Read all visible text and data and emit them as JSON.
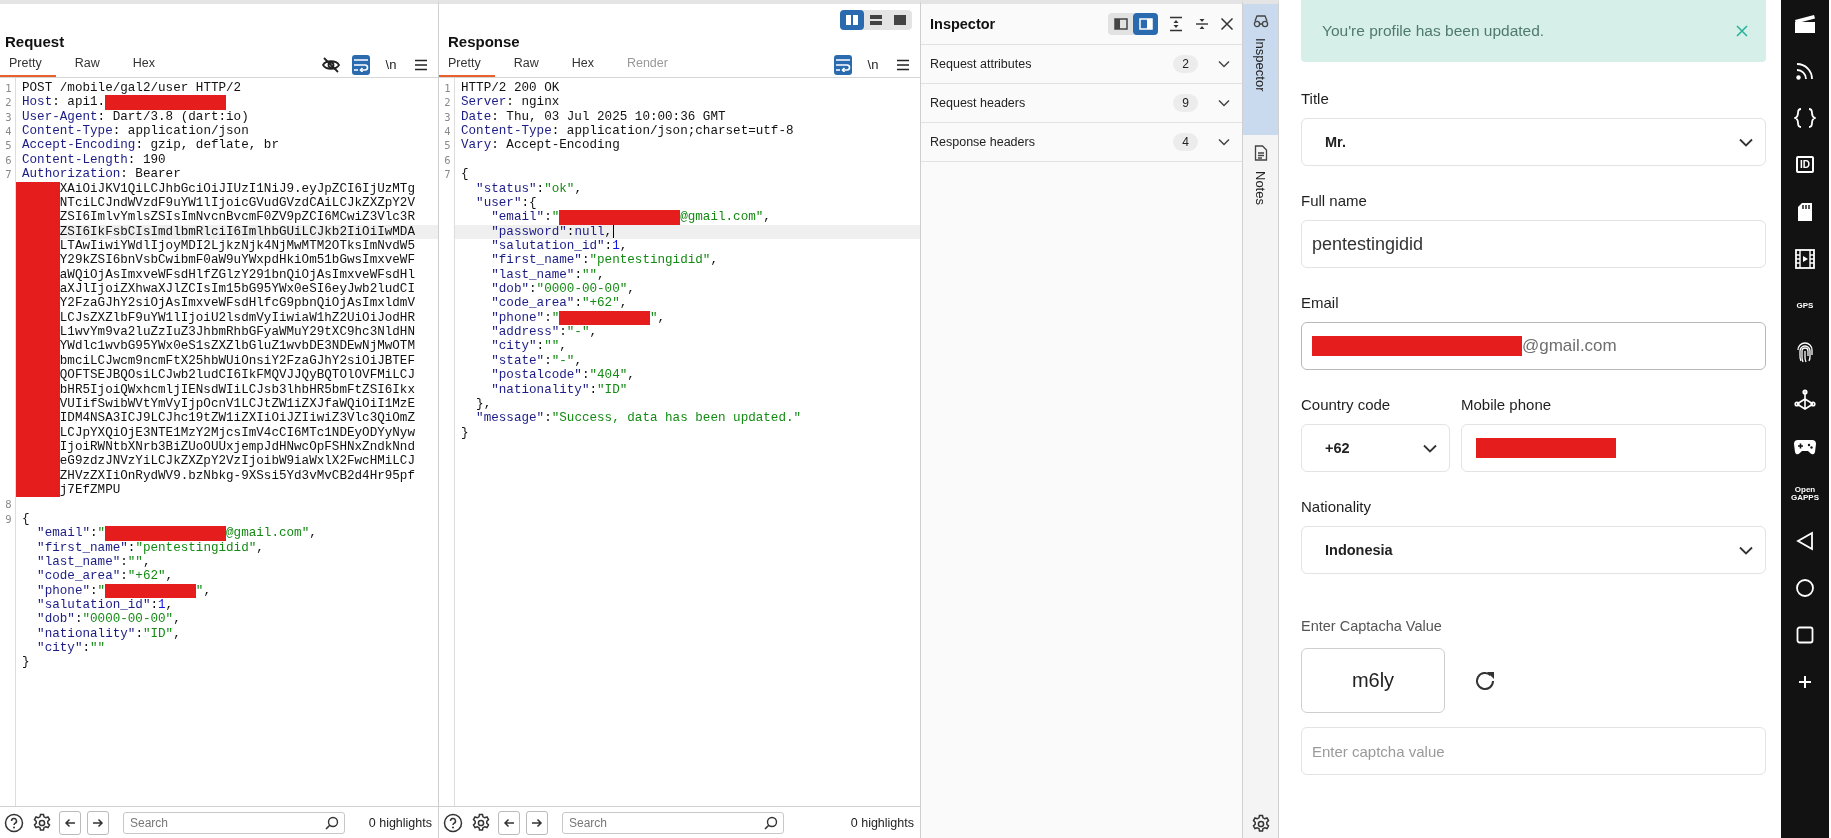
{
  "request_pane": {
    "title": "Request",
    "tabs": [
      {
        "label": "Pretty",
        "selected": true,
        "disabled": false
      },
      {
        "label": "Raw",
        "selected": false,
        "disabled": false
      },
      {
        "label": "Hex",
        "selected": false,
        "disabled": false
      }
    ],
    "toolbar": [
      {
        "kind": "eye-off",
        "on": false
      },
      {
        "kind": "wrap",
        "on": true
      },
      {
        "kind": "newline",
        "label": "\\n",
        "on": false
      },
      {
        "kind": "menu",
        "on": false
      }
    ],
    "lines": [
      {
        "number": "1",
        "highlighted": false,
        "parts": [
          {
            "kind": "plain",
            "text": "POST /mobile/gal2/user HTTP/2"
          }
        ]
      },
      {
        "number": "2",
        "highlighted": false,
        "parts": [
          {
            "kind": "key",
            "text": "Host"
          },
          {
            "kind": "plain",
            "text": ": api1."
          },
          {
            "kind": "redacted-long"
          }
        ]
      },
      {
        "number": "3",
        "highlighted": false,
        "parts": [
          {
            "kind": "key",
            "text": "User-Agent"
          },
          {
            "kind": "plain",
            "text": ": Dart/3.8 (dart:io)"
          }
        ]
      },
      {
        "number": "4",
        "highlighted": false,
        "parts": [
          {
            "kind": "key",
            "text": "Content-Type"
          },
          {
            "kind": "plain",
            "text": ": application/json"
          }
        ]
      },
      {
        "number": "5",
        "highlighted": false,
        "parts": [
          {
            "kind": "key",
            "text": "Accept-Encoding"
          },
          {
            "kind": "plain",
            "text": ": gzip, deflate, br"
          }
        ]
      },
      {
        "number": "6",
        "highlighted": false,
        "parts": [
          {
            "kind": "key",
            "text": "Content-Length"
          },
          {
            "kind": "plain",
            "text": ": 190"
          }
        ]
      },
      {
        "number": "7",
        "highlighted": false,
        "parts": [
          {
            "kind": "key",
            "text": "Authorization"
          },
          {
            "kind": "plain",
            "text": ": Bearer"
          }
        ]
      },
      {
        "highlighted": false,
        "parts": [
          {
            "kind": "redacted-token"
          },
          {
            "kind": "plain",
            "text": "XAiOiJKV1QiLCJhbGciOiJIUzI1NiJ9.eyJpZCI6IjUzMTg"
          }
        ]
      },
      {
        "highlighted": false,
        "parts": [
          {
            "kind": "redacted-token"
          },
          {
            "kind": "plain",
            "text": "NTciLCJndWVzdF9uYW1lIjoicGVudGVzdCAiLCJkZXZpY2V"
          }
        ]
      },
      {
        "highlighted": false,
        "parts": [
          {
            "kind": "redacted-token"
          },
          {
            "kind": "plain",
            "text": "ZSI6ImlvYmlsZSIsImNvcnBvcmF0ZV9pZCI6MCwiZ3Vlc3R"
          }
        ]
      },
      {
        "highlighted": true,
        "parts": [
          {
            "kind": "redacted-token"
          },
          {
            "kind": "plain",
            "text": "ZSI6IkFsbCIsImdlbmRlciI6ImlhbGUiLCJkb2IiOiIwMDA"
          }
        ]
      },
      {
        "highlighted": false,
        "parts": [
          {
            "kind": "redacted-token"
          },
          {
            "kind": "plain",
            "text": "LTAwIiwiYWdlIjoyMDI2LjkzNjk4NjMwMTM2OTksImNvdW5"
          }
        ]
      },
      {
        "highlighted": false,
        "parts": [
          {
            "kind": "redacted-token"
          },
          {
            "kind": "plain",
            "text": "Y29kZSI6bnVsbCwibmF0aW9uYWxpdHkiOm51bGwsImxveWF"
          }
        ]
      },
      {
        "highlighted": false,
        "parts": [
          {
            "kind": "redacted-token"
          },
          {
            "kind": "plain",
            "text": "aWQiOjAsImxveWFsdHlfZGlzY291bnQiOjAsImxveWFsdHl"
          }
        ]
      },
      {
        "highlighted": false,
        "parts": [
          {
            "kind": "redacted-token"
          },
          {
            "kind": "plain",
            "text": "aXJlIjoiZXhwaXJlZCIsIm15bG95YWx0eSI6eyJwb2ludCI"
          }
        ]
      },
      {
        "highlighted": false,
        "parts": [
          {
            "kind": "redacted-token"
          },
          {
            "kind": "plain",
            "text": "Y2FzaGJhY2siOjAsImxveWFsdHlfcG9pbnQiOjAsImxldmV"
          }
        ]
      },
      {
        "highlighted": false,
        "parts": [
          {
            "kind": "redacted-token"
          },
          {
            "kind": "plain",
            "text": "LCJsZXZlbF9uYW1lIjoiU2lsdmVyIiwiaW1hZ2UiOiJodHR"
          }
        ]
      },
      {
        "highlighted": false,
        "parts": [
          {
            "kind": "redacted-token"
          },
          {
            "kind": "plain",
            "text": "L1wvYm9va2luZzIuZ3JhbmRhbGFyaWMuY29tXC9hc3NldHN"
          }
        ]
      },
      {
        "highlighted": false,
        "parts": [
          {
            "kind": "redacted-token"
          },
          {
            "kind": "plain",
            "text": "YWdlc1wvbG95YWx0eS1sZXZlbGluZ1wvbDE3NDEwNjMwOTM"
          }
        ]
      },
      {
        "highlighted": false,
        "parts": [
          {
            "kind": "redacted-token"
          },
          {
            "kind": "plain",
            "text": "bmciLCJwcm9ncmFtX25hbWUiOnsiY2FzaGJhY2siOiJBTEF"
          }
        ]
      },
      {
        "highlighted": false,
        "parts": [
          {
            "kind": "redacted-token"
          },
          {
            "kind": "plain",
            "text": "QOFTSEJBQOsiLCJwb2ludCI6IkFMQVJJQyBQTOlOVFMiLCJ"
          }
        ]
      },
      {
        "highlighted": false,
        "parts": [
          {
            "kind": "redacted-token"
          },
          {
            "kind": "plain",
            "text": "bHR5IjoiQWxhcmljIENsdWIiLCJsb3lhbHR5bmFtZSI6Ikx"
          }
        ]
      },
      {
        "highlighted": false,
        "parts": [
          {
            "kind": "redacted-token"
          },
          {
            "kind": "plain",
            "text": "VUIifSwibWVtYmVyIjpOcnV1LCJtZW1iZXJfaWQiOiI1MzE"
          }
        ]
      },
      {
        "highlighted": false,
        "parts": [
          {
            "kind": "redacted-token"
          },
          {
            "kind": "plain",
            "text": "IDM4NSA3ICJ9LCJhc19tZW1iZXIiOiJZIiwiZ3Vlc3QiOmZ"
          }
        ]
      },
      {
        "highlighted": false,
        "parts": [
          {
            "kind": "redacted-token"
          },
          {
            "kind": "plain",
            "text": "LCJpYXQiOjE3NTE1MzY2MjcsImV4cCI6MTc1NDEyODYyNyw"
          }
        ]
      },
      {
        "highlighted": false,
        "parts": [
          {
            "kind": "redacted-token"
          },
          {
            "kind": "plain",
            "text": "IjoiRWNtbXNrb3BiZUoOUUxjempJdHNwcOpFSHNxZndkNnd"
          }
        ]
      },
      {
        "highlighted": false,
        "parts": [
          {
            "kind": "redacted-token"
          },
          {
            "kind": "plain",
            "text": "eG9zdzJNVzYiLCJkZXZpY2VzIjoibW9iaWxlX2FwcHMiLCJ"
          }
        ]
      },
      {
        "highlighted": false,
        "parts": [
          {
            "kind": "redacted-token"
          },
          {
            "kind": "plain",
            "text": "ZHVzZXIiOnRydWV9.bzNbkg-9XSsi5Yd3vMvCB2d4Hr95pf"
          }
        ]
      },
      {
        "highlighted": false,
        "parts": [
          {
            "kind": "redacted-token"
          },
          {
            "kind": "plain",
            "text": "j7EfZMPU"
          }
        ]
      },
      {
        "number": "8",
        "highlighted": false
      },
      {
        "number": "9",
        "highlighted": false,
        "parts": [
          {
            "kind": "plain",
            "text": "{"
          }
        ]
      },
      {
        "highlighted": false,
        "parts": [
          {
            "kind": "key",
            "text": "  \"email\""
          },
          {
            "kind": "plain",
            "text": ":"
          },
          {
            "kind": "string",
            "text": "\""
          },
          {
            "kind": "redacted-long"
          },
          {
            "kind": "string",
            "text": "@gmail.com\""
          },
          {
            "kind": "plain",
            "text": ","
          }
        ]
      },
      {
        "highlighted": false,
        "parts": [
          {
            "kind": "key",
            "text": "  \"first_name\""
          },
          {
            "kind": "plain",
            "text": ":"
          },
          {
            "kind": "string",
            "text": "\"pentestingidid\""
          },
          {
            "kind": "plain",
            "text": ","
          }
        ]
      },
      {
        "highlighted": false,
        "parts": [
          {
            "kind": "key",
            "text": "  \"last_name\""
          },
          {
            "kind": "plain",
            "text": ":"
          },
          {
            "kind": "string",
            "text": "\"\""
          },
          {
            "kind": "plain",
            "text": ","
          }
        ]
      },
      {
        "highlighted": false,
        "parts": [
          {
            "kind": "key",
            "text": "  \"code_area\""
          },
          {
            "kind": "plain",
            "text": ":"
          },
          {
            "kind": "string",
            "text": "\"+62\""
          },
          {
            "kind": "plain",
            "text": ","
          }
        ]
      },
      {
        "highlighted": false,
        "parts": [
          {
            "kind": "key",
            "text": "  \"phone\""
          },
          {
            "kind": "plain",
            "text": ":"
          },
          {
            "kind": "string",
            "text": "\""
          },
          {
            "kind": "redacted-short"
          },
          {
            "kind": "string",
            "text": "\""
          },
          {
            "kind": "plain",
            "text": ","
          }
        ]
      },
      {
        "highlighted": false,
        "parts": [
          {
            "kind": "key",
            "text": "  \"salutation_id\""
          },
          {
            "kind": "plain",
            "text": ":"
          },
          {
            "kind": "number",
            "text": "1"
          },
          {
            "kind": "plain",
            "text": ","
          }
        ]
      },
      {
        "highlighted": false,
        "parts": [
          {
            "kind": "key",
            "text": "  \"dob\""
          },
          {
            "kind": "plain",
            "text": ":"
          },
          {
            "kind": "string",
            "text": "\"0000-00-00\""
          },
          {
            "kind": "plain",
            "text": ","
          }
        ]
      },
      {
        "highlighted": false,
        "parts": [
          {
            "kind": "key",
            "text": "  \"nationality\""
          },
          {
            "kind": "plain",
            "text": ":"
          },
          {
            "kind": "string",
            "text": "\"ID\""
          },
          {
            "kind": "plain",
            "text": ","
          }
        ]
      },
      {
        "highlighted": false,
        "parts": [
          {
            "kind": "key",
            "text": "  \"city\""
          },
          {
            "kind": "plain",
            "text": ":"
          },
          {
            "kind": "string",
            "text": "\"\""
          }
        ]
      },
      {
        "highlighted": false,
        "parts": [
          {
            "kind": "plain",
            "text": "}"
          }
        ]
      }
    ],
    "search": {
      "placeholder": "Search"
    },
    "highlights": "0 highlights"
  },
  "response_pane": {
    "title": "Response",
    "view_toggle": [
      {
        "kind": "columns",
        "selected": true
      },
      {
        "kind": "rows",
        "selected": false
      },
      {
        "kind": "single",
        "selected": false
      }
    ],
    "tabs": [
      {
        "label": "Pretty",
        "selected": true,
        "disabled": false
      },
      {
        "label": "Raw",
        "selected": false,
        "disabled": false
      },
      {
        "label": "Hex",
        "selected": false,
        "disabled": false
      },
      {
        "label": "Render",
        "selected": false,
        "disabled": true
      }
    ],
    "toolbar": [
      {
        "kind": "wrap",
        "on": true
      },
      {
        "kind": "newline",
        "label": "\\n",
        "on": false
      },
      {
        "kind": "menu",
        "on": false
      }
    ],
    "lines": [
      {
        "number": "1",
        "highlighted": false,
        "parts": [
          {
            "kind": "plain",
            "text": "HTTP/2 200 OK"
          }
        ]
      },
      {
        "number": "2",
        "highlighted": false,
        "parts": [
          {
            "kind": "key",
            "text": "Server"
          },
          {
            "kind": "plain",
            "text": ": nginx"
          }
        ]
      },
      {
        "number": "3",
        "highlighted": false,
        "parts": [
          {
            "kind": "key",
            "text": "Date"
          },
          {
            "kind": "plain",
            "text": ": Thu, 03 Jul 2025 10:00:36 GMT"
          }
        ]
      },
      {
        "number": "4",
        "highlighted": false,
        "parts": [
          {
            "kind": "key",
            "text": "Content-Type"
          },
          {
            "kind": "plain",
            "text": ": application/json;charset=utf-8"
          }
        ]
      },
      {
        "number": "5",
        "highlighted": false,
        "parts": [
          {
            "kind": "key",
            "text": "Vary"
          },
          {
            "kind": "plain",
            "text": ": Accept-Encoding"
          }
        ]
      },
      {
        "number": "6",
        "highlighted": false
      },
      {
        "number": "7",
        "highlighted": false,
        "parts": [
          {
            "kind": "plain",
            "text": "{"
          }
        ]
      },
      {
        "highlighted": false,
        "parts": [
          {
            "kind": "key",
            "text": "  \"status\""
          },
          {
            "kind": "plain",
            "text": ":"
          },
          {
            "kind": "string",
            "text": "\"ok\""
          },
          {
            "kind": "plain",
            "text": ","
          }
        ]
      },
      {
        "highlighted": false,
        "parts": [
          {
            "kind": "key",
            "text": "  \"user\""
          },
          {
            "kind": "plain",
            "text": ":{"
          }
        ]
      },
      {
        "highlighted": false,
        "parts": [
          {
            "kind": "key",
            "text": "    \"email\""
          },
          {
            "kind": "plain",
            "text": ":"
          },
          {
            "kind": "string",
            "text": "\""
          },
          {
            "kind": "redacted-long"
          },
          {
            "kind": "string",
            "text": "@gmail.com\""
          },
          {
            "kind": "plain",
            "text": ","
          }
        ]
      },
      {
        "highlighted": true,
        "parts": [
          {
            "kind": "key",
            "text": "    \"password\""
          },
          {
            "kind": "plain",
            "text": ":"
          },
          {
            "kind": "literal",
            "text": "null"
          },
          {
            "kind": "plain",
            "text": ","
          },
          {
            "kind": "caret"
          }
        ]
      },
      {
        "highlighted": false,
        "parts": [
          {
            "kind": "key",
            "text": "    \"salutation_id\""
          },
          {
            "kind": "plain",
            "text": ":"
          },
          {
            "kind": "number",
            "text": "1"
          },
          {
            "kind": "plain",
            "text": ","
          }
        ]
      },
      {
        "highlighted": false,
        "parts": [
          {
            "kind": "key",
            "text": "    \"first_name\""
          },
          {
            "kind": "plain",
            "text": ":"
          },
          {
            "kind": "string",
            "text": "\"pentestingidid\""
          },
          {
            "kind": "plain",
            "text": ","
          }
        ]
      },
      {
        "highlighted": false,
        "parts": [
          {
            "kind": "key",
            "text": "    \"last_name\""
          },
          {
            "kind": "plain",
            "text": ":"
          },
          {
            "kind": "string",
            "text": "\"\""
          },
          {
            "kind": "plain",
            "text": ","
          }
        ]
      },
      {
        "highlighted": false,
        "parts": [
          {
            "kind": "key",
            "text": "    \"dob\""
          },
          {
            "kind": "plain",
            "text": ":"
          },
          {
            "kind": "string",
            "text": "\"0000-00-00\""
          },
          {
            "kind": "plain",
            "text": ","
          }
        ]
      },
      {
        "highlighted": false,
        "parts": [
          {
            "kind": "key",
            "text": "    \"code_area\""
          },
          {
            "kind": "plain",
            "text": ":"
          },
          {
            "kind": "string",
            "text": "\"+62\""
          },
          {
            "kind": "plain",
            "text": ","
          }
        ]
      },
      {
        "highlighted": false,
        "parts": [
          {
            "kind": "key",
            "text": "    \"phone\""
          },
          {
            "kind": "plain",
            "text": ":"
          },
          {
            "kind": "string",
            "text": "\""
          },
          {
            "kind": "redacted-short"
          },
          {
            "kind": "string",
            "text": "\""
          },
          {
            "kind": "plain",
            "text": ","
          }
        ]
      },
      {
        "highlighted": false,
        "parts": [
          {
            "kind": "key",
            "text": "    \"address\""
          },
          {
            "kind": "plain",
            "text": ":"
          },
          {
            "kind": "string",
            "text": "\"-\""
          },
          {
            "kind": "plain",
            "text": ","
          }
        ]
      },
      {
        "highlighted": false,
        "parts": [
          {
            "kind": "key",
            "text": "    \"city\""
          },
          {
            "kind": "plain",
            "text": ":"
          },
          {
            "kind": "string",
            "text": "\"\""
          },
          {
            "kind": "plain",
            "text": ","
          }
        ]
      },
      {
        "highlighted": false,
        "parts": [
          {
            "kind": "key",
            "text": "    \"state\""
          },
          {
            "kind": "plain",
            "text": ":"
          },
          {
            "kind": "string",
            "text": "\"-\""
          },
          {
            "kind": "plain",
            "text": ","
          }
        ]
      },
      {
        "highlighted": false,
        "parts": [
          {
            "kind": "key",
            "text": "    \"postalcode\""
          },
          {
            "kind": "plain",
            "text": ":"
          },
          {
            "kind": "string",
            "text": "\"404\""
          },
          {
            "kind": "plain",
            "text": ","
          }
        ]
      },
      {
        "highlighted": false,
        "parts": [
          {
            "kind": "key",
            "text": "    \"nationality\""
          },
          {
            "kind": "plain",
            "text": ":"
          },
          {
            "kind": "string",
            "text": "\"ID\""
          }
        ]
      },
      {
        "highlighted": false,
        "parts": [
          {
            "kind": "plain",
            "text": "  },"
          }
        ]
      },
      {
        "highlighted": false,
        "parts": [
          {
            "kind": "key",
            "text": "  \"message\""
          },
          {
            "kind": "plain",
            "text": ":"
          },
          {
            "kind": "string",
            "text": "\"Success, data has been updated.\""
          }
        ]
      },
      {
        "highlighted": false,
        "parts": [
          {
            "kind": "plain",
            "text": "}"
          }
        ]
      }
    ],
    "search": {
      "placeholder": "Search"
    },
    "highlights": "0 highlights"
  },
  "inspector": {
    "title": "Inspector",
    "layout_toggle": [
      {
        "kind": "left",
        "selected": false
      },
      {
        "kind": "right",
        "selected": true
      }
    ],
    "sections": [
      {
        "label": "Request attributes",
        "count": "2",
        "expanded": false
      },
      {
        "label": "Request headers",
        "count": "9",
        "expanded": false
      },
      {
        "label": "Response headers",
        "count": "4",
        "expanded": false
      }
    ]
  },
  "side_tabs": [
    {
      "kind": "inspector",
      "label": "Inspector",
      "selected": true
    },
    {
      "kind": "notes",
      "label": "Notes",
      "selected": false
    }
  ],
  "app": {
    "toast": {
      "message": "You're profile has been updated."
    },
    "fields": [
      {
        "kind": "select",
        "label": "Title",
        "value": "Mr.",
        "focused": false
      },
      {
        "kind": "text",
        "label": "Full name",
        "value": "pentestingidid",
        "focused": false
      },
      {
        "kind": "redacted",
        "label": "Email",
        "value": "@gmail.com",
        "focused": true
      },
      {
        "kind": "pair",
        "fields": [
          {
            "kind": "select",
            "label": "Country code",
            "value": "+62",
            "focused": false
          },
          {
            "kind": "redacted",
            "label": "Mobile phone",
            "focused": false
          }
        ]
      },
      {
        "kind": "select",
        "label": "Nationality",
        "value": "Indonesia",
        "focused": false
      },
      {
        "kind": "captcha",
        "label": "Enter Captacha Value",
        "code": "m6ly"
      },
      {
        "kind": "text",
        "placeholder": "Enter captcha value",
        "focused": false
      }
    ]
  },
  "emulator_toolbar": [
    {
      "kind": "clapper"
    },
    {
      "kind": "cast"
    },
    {
      "kind": "braces"
    },
    {
      "kind": "id-card",
      "label": "ID"
    },
    {
      "kind": "sd-card"
    },
    {
      "kind": "film"
    },
    {
      "kind": "gps",
      "label": "GPS"
    },
    {
      "kind": "fingerprint"
    },
    {
      "kind": "network"
    },
    {
      "kind": "gamepad"
    },
    {
      "kind": "gapps",
      "label": "Open GAPPS"
    },
    {
      "kind": "back"
    },
    {
      "kind": "home"
    },
    {
      "kind": "recents"
    },
    {
      "kind": "plus"
    }
  ]
}
